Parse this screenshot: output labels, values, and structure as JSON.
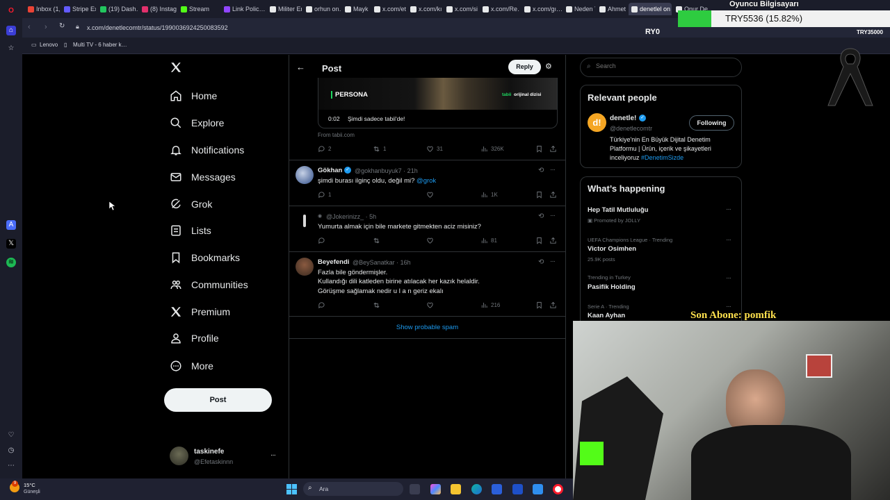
{
  "browser": {
    "tabs": [
      {
        "label": "Inbox (1,…",
        "color": "#ea4335"
      },
      {
        "label": "Stripe Ex…",
        "color": "#635bff"
      },
      {
        "label": "(19) Dash…",
        "color": "#22c55e"
      },
      {
        "label": "(8) Instag…",
        "color": "#e1306c"
      },
      {
        "label": "Stream",
        "color": "#53fc18"
      },
      {
        "label": "Link Polic…",
        "color": "#9146ff"
      },
      {
        "label": "Militer Er…",
        "color": "#e7e9ea"
      },
      {
        "label": "orhun on…",
        "color": "#e7e9ea"
      },
      {
        "label": "Mayk İnş…",
        "color": "#e7e9ea"
      },
      {
        "label": "x.com/et…",
        "color": "#e7e9ea"
      },
      {
        "label": "x.com/kı…",
        "color": "#e7e9ea"
      },
      {
        "label": "x.com/si…",
        "color": "#e7e9ea"
      },
      {
        "label": "x.com/Re…",
        "color": "#e7e9ea"
      },
      {
        "label": "x.com/gı…",
        "color": "#e7e9ea"
      },
      {
        "label": "Neden T…",
        "color": "#e7e9ea"
      },
      {
        "label": "Ahmet s…",
        "color": "#e7e9ea"
      },
      {
        "label": "denetlel on X…",
        "color": "#e7e9ea"
      },
      {
        "label": "Onur De…",
        "color": "#e7e9ea"
      }
    ],
    "url": "x.com/denetlecomtr/status/1990036924250083592",
    "bookmarks": [
      "Lenovo",
      "Multi TV - 6 haber k…"
    ]
  },
  "overlay": {
    "goal_title": "Oyuncu Bilgisayarı",
    "goal_progress": "TRY5536 (15.82%)",
    "goal_fraction": 0.1582,
    "goal_min": "RY0",
    "goal_max": "TRY35000",
    "last_sub": "Son Abone: pomfik"
  },
  "nav": {
    "home": "Home",
    "explore": "Explore",
    "notifications": "Notifications",
    "messages": "Messages",
    "grok": "Grok",
    "lists": "Lists",
    "bookmarks": "Bookmarks",
    "communities": "Communities",
    "premium": "Premium",
    "profile": "Profile",
    "more": "More",
    "post_button": "Post"
  },
  "account": {
    "name": "taskinefe",
    "handle": "@Efetaskinnn"
  },
  "header": {
    "title": "Post",
    "reply_button": "Reply"
  },
  "media_card": {
    "brand": "PERSONA",
    "tag_brand": "tabii",
    "tag_text": "orijinal dizisi",
    "time": "0:02",
    "caption": "Şimdi sadece tabii'de!",
    "source": "From tabii.com"
  },
  "main_actions": {
    "replies": "2",
    "reposts": "1",
    "likes": "31",
    "views": "326K"
  },
  "replies": [
    {
      "name": "Gökhan",
      "handle": "@gokhanbuyuk7 · 21h",
      "text": "şimdi burası ilginç oldu, değil mi?",
      "mention": "@grok",
      "replies": "1",
      "views": "1K"
    },
    {
      "name": "",
      "handle": "@Jokerinizz_ · 5h",
      "text": "Yumurta almak için bile markete gitmekten aciz misiniz?",
      "views": "81"
    },
    {
      "name": "Beyefendi",
      "handle": "@BeySanatkar · 16h",
      "lines": [
        "Fazla bile göndermişler.",
        "Kullandığı dili katleden birine atılacak her kazık helaldir.",
        "Görüşme sağlamak nedir u l a n geriz ekalı"
      ],
      "views": "216"
    }
  ],
  "show_spam": "Show probable spam",
  "search": {
    "placeholder": "Search"
  },
  "relevant": {
    "title": "Relevant people",
    "name": "denetle!",
    "handle": "@denetlecomtr",
    "follow_button": "Following",
    "bio": "Türkiye'nin En Büyük Dijital Denetim Platformu | Ürün, içerik ve şikayetleri inceliyoruz",
    "hashtag": "#DenetimSizde"
  },
  "happening": {
    "title": "What’s happening",
    "trends": [
      {
        "sub": "",
        "title": "Hep Tatil Mutluluğu",
        "meta": "Promoted by JOLLY"
      },
      {
        "sub": "UEFA Champions League · Trending",
        "title": "Victor Osimhen",
        "meta": "25.9K posts"
      },
      {
        "sub": "Trending in Turkey",
        "title": "Pasifik Holding",
        "meta": ""
      },
      {
        "sub": "Serie A · Trending",
        "title": "Kaan Ayhan",
        "meta": ""
      }
    ]
  },
  "taskbar": {
    "temp": "15°C",
    "weather": "Güneşli",
    "search": "Ara",
    "weather_badge": "9"
  }
}
